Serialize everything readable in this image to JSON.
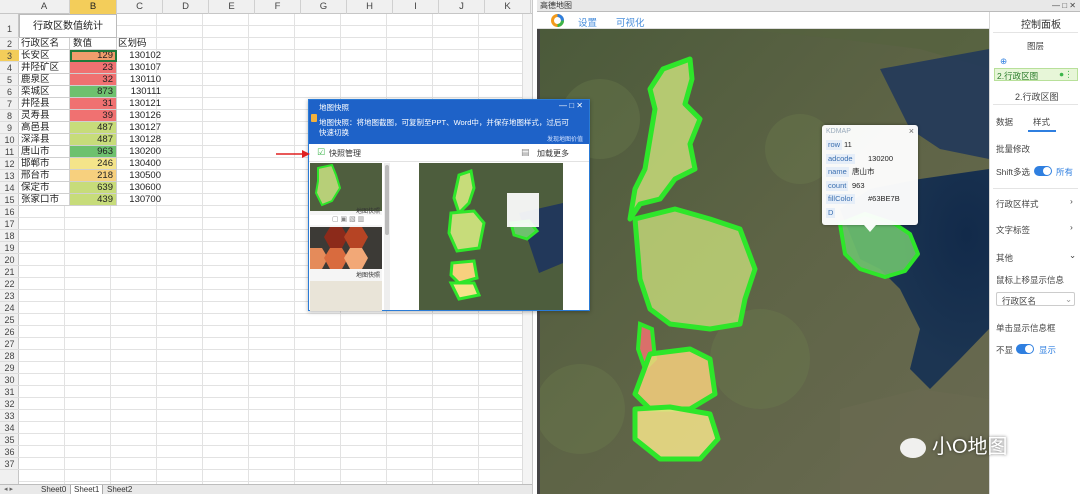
{
  "spreadsheet": {
    "columns": [
      "A",
      "B",
      "C",
      "D",
      "E",
      "F",
      "G",
      "H",
      "I",
      "J",
      "K"
    ],
    "selected_column": "B",
    "selected_row": 3,
    "row_numbers": [
      "1",
      "2",
      "3",
      "4",
      "5",
      "6",
      "7",
      "8",
      "9",
      "10",
      "11",
      "12",
      "13",
      "14",
      "15",
      "16",
      "17",
      "18",
      "19",
      "20",
      "21",
      "22",
      "23",
      "24",
      "25",
      "26",
      "27",
      "28",
      "29",
      "30",
      "31",
      "32",
      "33",
      "34",
      "35",
      "36",
      "37"
    ],
    "title": "行政区数值统计",
    "headers": {
      "name": "行政区名",
      "value": "数值",
      "code": "区划码"
    },
    "rows": [
      {
        "name": "长安区",
        "value": "129",
        "code": "130102",
        "color": "#ef9d6c"
      },
      {
        "name": "井陉矿区",
        "value": "23",
        "code": "130107",
        "color": "#f07171"
      },
      {
        "name": "鹿泉区",
        "value": "32",
        "code": "130110",
        "color": "#f07171"
      },
      {
        "name": "栾城区",
        "value": "873",
        "code": "130111",
        "color": "#6ec16e"
      },
      {
        "name": "井陉县",
        "value": "31",
        "code": "130121",
        "color": "#f07171"
      },
      {
        "name": "灵寿县",
        "value": "39",
        "code": "130126",
        "color": "#f07171"
      },
      {
        "name": "高邑县",
        "value": "487",
        "code": "130127",
        "color": "#c7dc7a"
      },
      {
        "name": "深泽县",
        "value": "487",
        "code": "130128",
        "color": "#c7dc7a"
      },
      {
        "name": "唐山市",
        "value": "963",
        "code": "130200",
        "color": "#6ec16e"
      },
      {
        "name": "邯郸市",
        "value": "246",
        "code": "130400",
        "color": "#f4e48a"
      },
      {
        "name": "邢台市",
        "value": "218",
        "code": "130500",
        "color": "#f7d07e"
      },
      {
        "name": "保定市",
        "value": "639",
        "code": "130600",
        "color": "#c7dc7a"
      },
      {
        "name": "张家口市",
        "value": "439",
        "code": "130700",
        "color": "#c7dc7a"
      }
    ],
    "sheet_tabs": [
      "Sheet0",
      "Sheet1",
      "Sheet2"
    ],
    "active_tab": "Sheet1"
  },
  "map_window": {
    "caption": "高德地图",
    "toolbar": {
      "settings": "设置",
      "visualize": "可视化"
    },
    "panel": {
      "title": "控制面板",
      "layers_label": "图层",
      "layer_item": "2.行政区图",
      "layer_heading": "2.行政区图",
      "tabs": [
        "数据",
        "样式"
      ],
      "active_tab": "样式",
      "batch_edit": "批量修改",
      "shift_select": "Shift多选",
      "all": "所有",
      "region_style": "行政区样式",
      "text_label": "文字标签",
      "other": "其他",
      "hover_info": "鼠标上移显示信息",
      "hover_field": "行政区名",
      "click_info": "单击显示信息框",
      "hide": "不显",
      "show": "显示"
    },
    "info_popup": {
      "header": "KDMAP",
      "fields": [
        {
          "key": "row",
          "value": "11"
        },
        {
          "key": "adcode",
          "value": "130200"
        },
        {
          "key": "name",
          "value": "唐山市"
        },
        {
          "key": "count",
          "value": "963"
        },
        {
          "key": "fillColor",
          "value": "#63BE7B"
        },
        {
          "key": "D",
          "value": ""
        }
      ]
    },
    "watermark": "小O地图"
  },
  "snapshot_dialog": {
    "title": "地图快照",
    "description": "地图快照：将地图截图，可复制至PPT、Word中，并保存地图样式，过后可快速切换",
    "link": "发现地图价值",
    "manage": "快照管理",
    "load_more": "加载更多",
    "thumb_label_1": "地图快照",
    "thumb_label_2": "地图快照"
  },
  "colors": {
    "accent": "#2f7fe0",
    "region_outline": "#2ee62a",
    "title_bar": "#1e62c8"
  }
}
